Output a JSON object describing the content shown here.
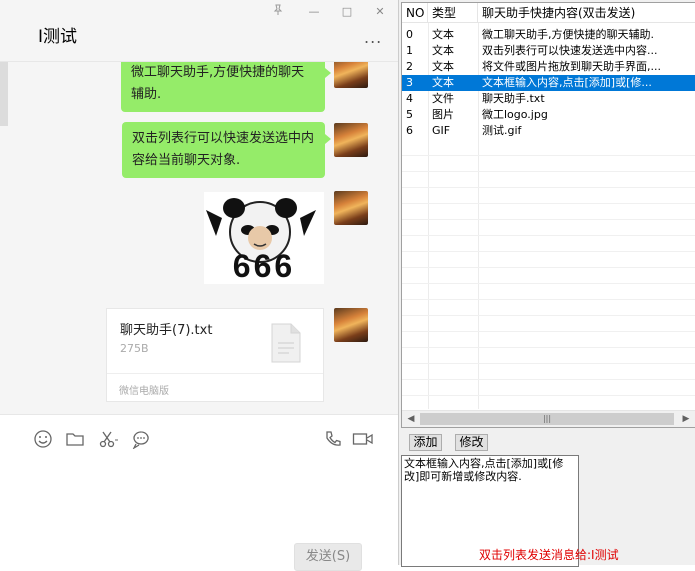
{
  "chat": {
    "title": "I测试",
    "more": "...",
    "window_controls": {
      "pin": "pin-icon",
      "minimize": "—",
      "maximize": "□",
      "close": "✕"
    },
    "messages": [
      {
        "type": "text",
        "text": "微工聊天助手,方便快捷的聊天辅助."
      },
      {
        "type": "text",
        "text": "双击列表行可以快速发送选中内容给当前聊天对象."
      },
      {
        "type": "sticker",
        "text": "666"
      },
      {
        "type": "file",
        "file_name": "聊天助手(7).txt",
        "file_size": "275B",
        "source": "微信电脑版"
      }
    ],
    "toolbar_icons": [
      "emoji-icon",
      "folder-icon",
      "scissors-icon",
      "chat-bubble-icon",
      "phone-icon",
      "video-icon"
    ],
    "send_label": "发送(S)"
  },
  "helper": {
    "columns": [
      "NO",
      "类型",
      "聊天助手快捷内容(双击发送)"
    ],
    "rows": [
      {
        "no": "0",
        "type": "文本",
        "content": "微工聊天助手,方便快捷的聊天辅助."
      },
      {
        "no": "1",
        "type": "文本",
        "content": "双击列表行可以快速发送选中内容..."
      },
      {
        "no": "2",
        "type": "文本",
        "content": "将文件或图片拖放到聊天助手界面,..."
      },
      {
        "no": "3",
        "type": "文本",
        "content": "文本框输入内容,点击[添加]或[修..."
      },
      {
        "no": "4",
        "type": "文件",
        "content": "聊天助手.txt"
      },
      {
        "no": "5",
        "type": "图片",
        "content": "微工logo.jpg"
      },
      {
        "no": "6",
        "type": "GIF",
        "content": "测试.gif"
      }
    ],
    "selected_row": 3,
    "scroll_thumb": "|||",
    "add_label": "添加",
    "edit_label": "修改",
    "input_text": "文本框输入内容,点击[添加]或[修改]即可新增或修改内容.",
    "status_text": "双击列表发送消息给:I测试",
    "colors": {
      "selection": "#0078d7",
      "status": "#e00000",
      "bubble": "#95ec69"
    }
  }
}
